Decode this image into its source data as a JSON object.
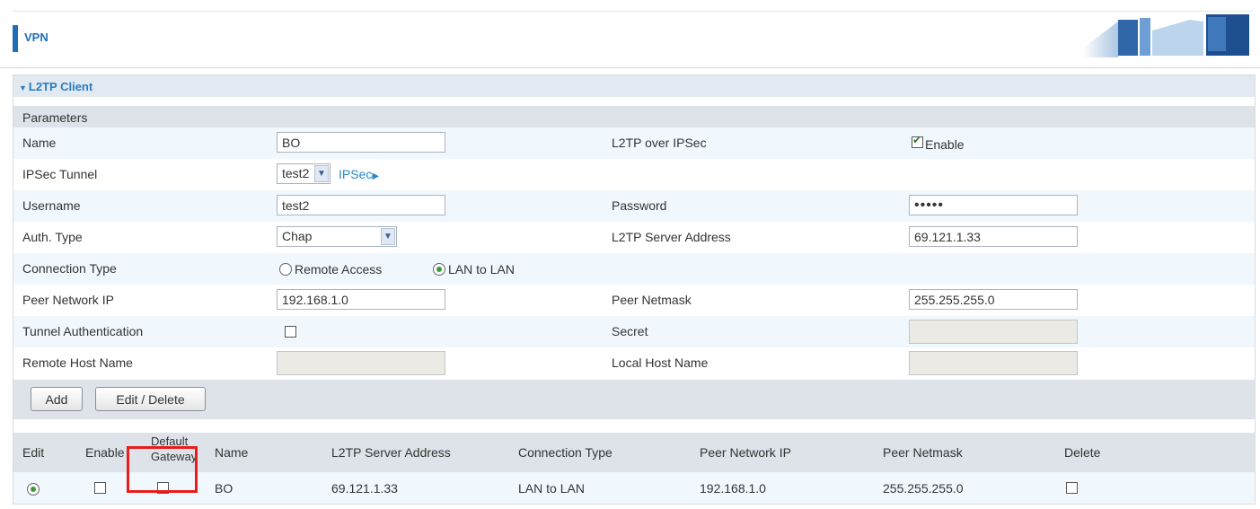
{
  "header": {
    "title": "VPN"
  },
  "section": {
    "title": "L2TP Client"
  },
  "params": {
    "heading": "Parameters",
    "name_label": "Name",
    "name_value": "BO",
    "l2tp_over_ipsec_label": "L2TP over IPSec",
    "enable_label": "Enable",
    "ipsec_tunnel_label": "IPSec Tunnel",
    "ipsec_tunnel_value": "test2",
    "ipsec_link": "IPSec",
    "username_label": "Username",
    "username_value": "test2",
    "password_label": "Password",
    "password_mask": "•••••",
    "auth_type_label": "Auth. Type",
    "auth_type_value": "Chap",
    "server_address_label": "L2TP Server Address",
    "server_address_value": "69.121.1.33",
    "connection_type_label": "Connection Type",
    "remote_access_label": "Remote Access",
    "lan_to_lan_label": "LAN to LAN",
    "peer_network_ip_label": "Peer Network IP",
    "peer_network_ip_value": "192.168.1.0",
    "peer_netmask_label": "Peer Netmask",
    "peer_netmask_value": "255.255.255.0",
    "tunnel_auth_label": "Tunnel Authentication",
    "secret_label": "Secret",
    "remote_host_label": "Remote Host Name",
    "local_host_label": "Local Host Name"
  },
  "buttons": {
    "add": "Add",
    "edit_delete": "Edit / Delete"
  },
  "table": {
    "headers": {
      "edit": "Edit",
      "enable": "Enable",
      "default_line1": "Default",
      "default_line2": "Gateway",
      "name": "Name",
      "server": "L2TP Server Address",
      "conn_type": "Connection Type",
      "peer_ip": "Peer Network IP",
      "peer_mask": "Peer Netmask",
      "delete": "Delete"
    },
    "rows": [
      {
        "name": "BO",
        "server": "69.121.1.33",
        "conn_type": "LAN to LAN",
        "peer_ip": "192.168.1.0",
        "peer_mask": "255.255.255.0"
      }
    ]
  }
}
